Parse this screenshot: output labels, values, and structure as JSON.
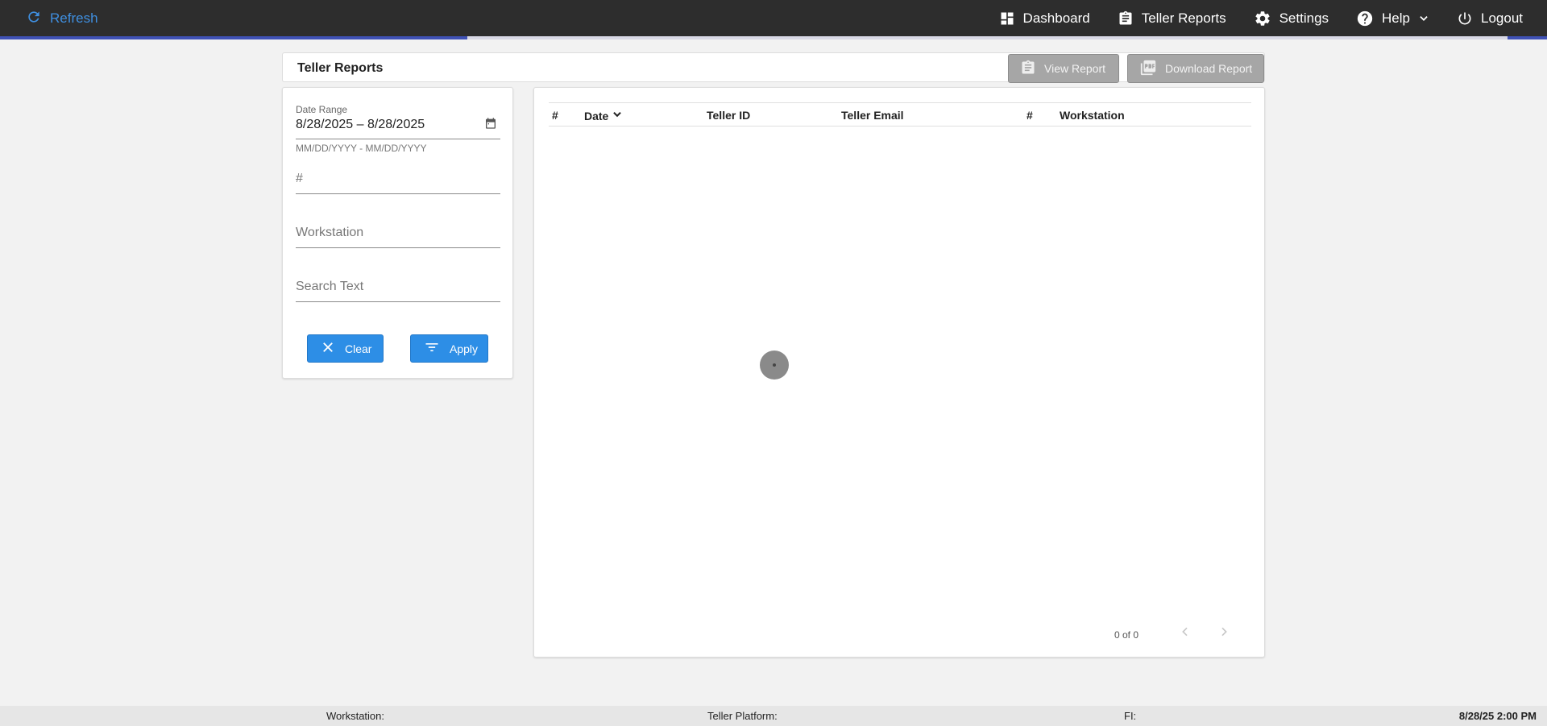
{
  "topbar": {
    "refresh_label": "Refresh",
    "nav": {
      "dashboard": "Dashboard",
      "teller_reports": "Teller Reports",
      "settings": "Settings",
      "help": "Help",
      "logout": "Logout"
    }
  },
  "page": {
    "title": "Teller Reports",
    "view_report": "View Report",
    "download_report": "Download Report"
  },
  "filters": {
    "date_range_label": "Date Range",
    "date_range_value": "8/28/2025 – 8/28/2025",
    "date_range_hint": "MM/DD/YYYY - MM/DD/YYYY",
    "number_placeholder": "#",
    "workstation_placeholder": "Workstation",
    "search_placeholder": "Search Text",
    "clear_label": "Clear",
    "apply_label": "Apply"
  },
  "table": {
    "columns": [
      "#",
      "Date",
      "Teller ID",
      "Teller Email",
      "#",
      "Workstation"
    ],
    "rows": [],
    "pagination": "0 of 0"
  },
  "footer": {
    "workstation": "Workstation:",
    "platform": "Teller Platform:",
    "fi": "FI:",
    "datetime": "8/28/25 2:00 PM"
  },
  "colors": {
    "topbar": "#2d2d2d",
    "accent": "#2d8ee6",
    "progress": "#3f51b5",
    "disabled_button": "#a6a6a6"
  }
}
